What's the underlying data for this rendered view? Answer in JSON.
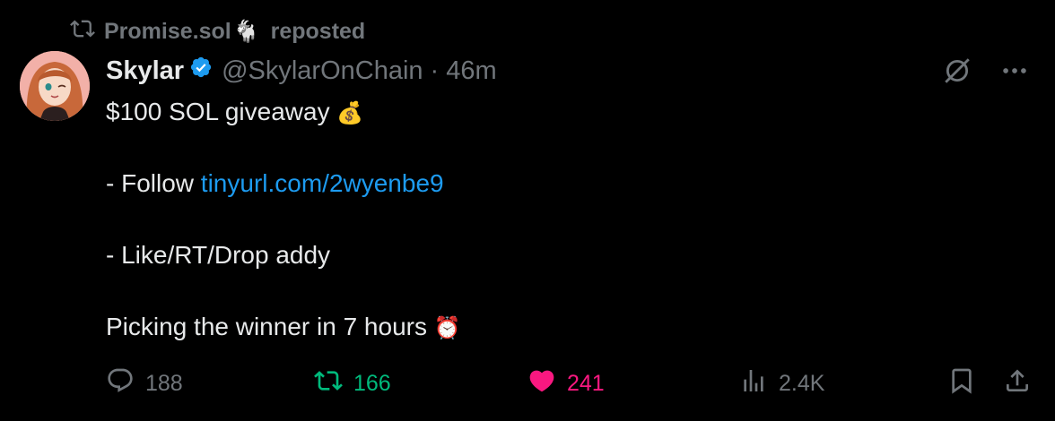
{
  "repost": {
    "user": "Promise.sol",
    "goat_emoji": "🐐",
    "label": "reposted"
  },
  "tweet": {
    "author_name": "Skylar",
    "handle": "@SkylarOnChain",
    "separator": "·",
    "time": "46m",
    "lines": {
      "l1": "$100 SOL giveaway",
      "l1_emoji": "💰",
      "l2_prefix": "- Follow ",
      "l2_link": "tinyurl.com/2wyenbe9",
      "l3": "- Like/RT/Drop addy",
      "l4": "Picking the winner in 7 hours",
      "l4_emoji": "⏰"
    }
  },
  "stats": {
    "replies": "188",
    "reposts": "166",
    "likes": "241",
    "views": "2.4K"
  },
  "icons": {
    "repost": "repost-icon",
    "verified": "verified-badge-icon",
    "grok": "grok-icon",
    "more": "more-icon",
    "reply": "reply-icon",
    "retweet": "retweet-icon",
    "like": "heart-icon",
    "views": "views-icon",
    "bookmark": "bookmark-icon",
    "share": "share-icon"
  },
  "colors": {
    "background": "#000000",
    "text": "#e7e9ea",
    "muted": "#71767b",
    "link": "#1d9bf0",
    "retweet_active": "#00ba7c",
    "like_active": "#f91880",
    "verified": "#1d9bf0"
  }
}
